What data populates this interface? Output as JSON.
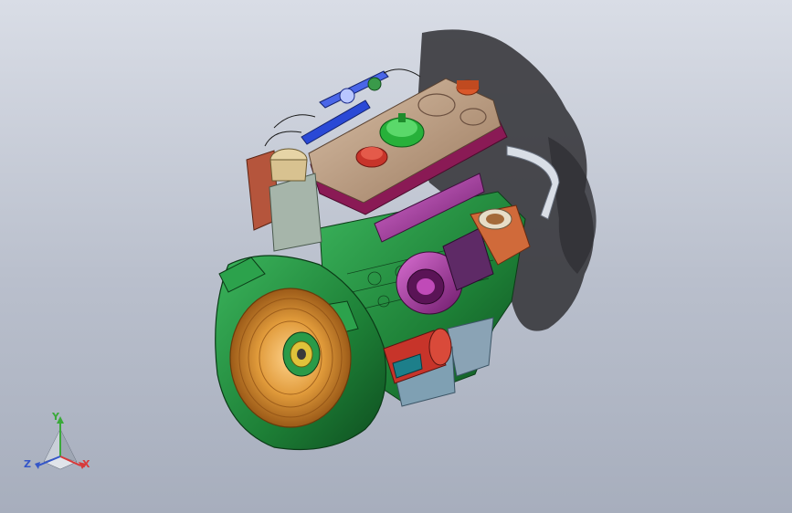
{
  "colors": {
    "background_top": "#d9dde6",
    "background_bottom": "#a7aebd",
    "housing_green": "#1f8a3a",
    "flywheel_orange": "#d98c2b",
    "cover_tan": "#b59479",
    "turbo_magenta": "#a0309a",
    "pipe_blue": "#2a49d6",
    "cap_green": "#27b13a",
    "cap_red": "#c7342a",
    "axis_x": "#d83a3a",
    "axis_y": "#3aa93a",
    "axis_z": "#3456c8"
  },
  "triad": {
    "x_label": "X",
    "y_label": "Y",
    "z_label": "Z"
  },
  "icons": {
    "triad": "xyz-triad-icon"
  }
}
